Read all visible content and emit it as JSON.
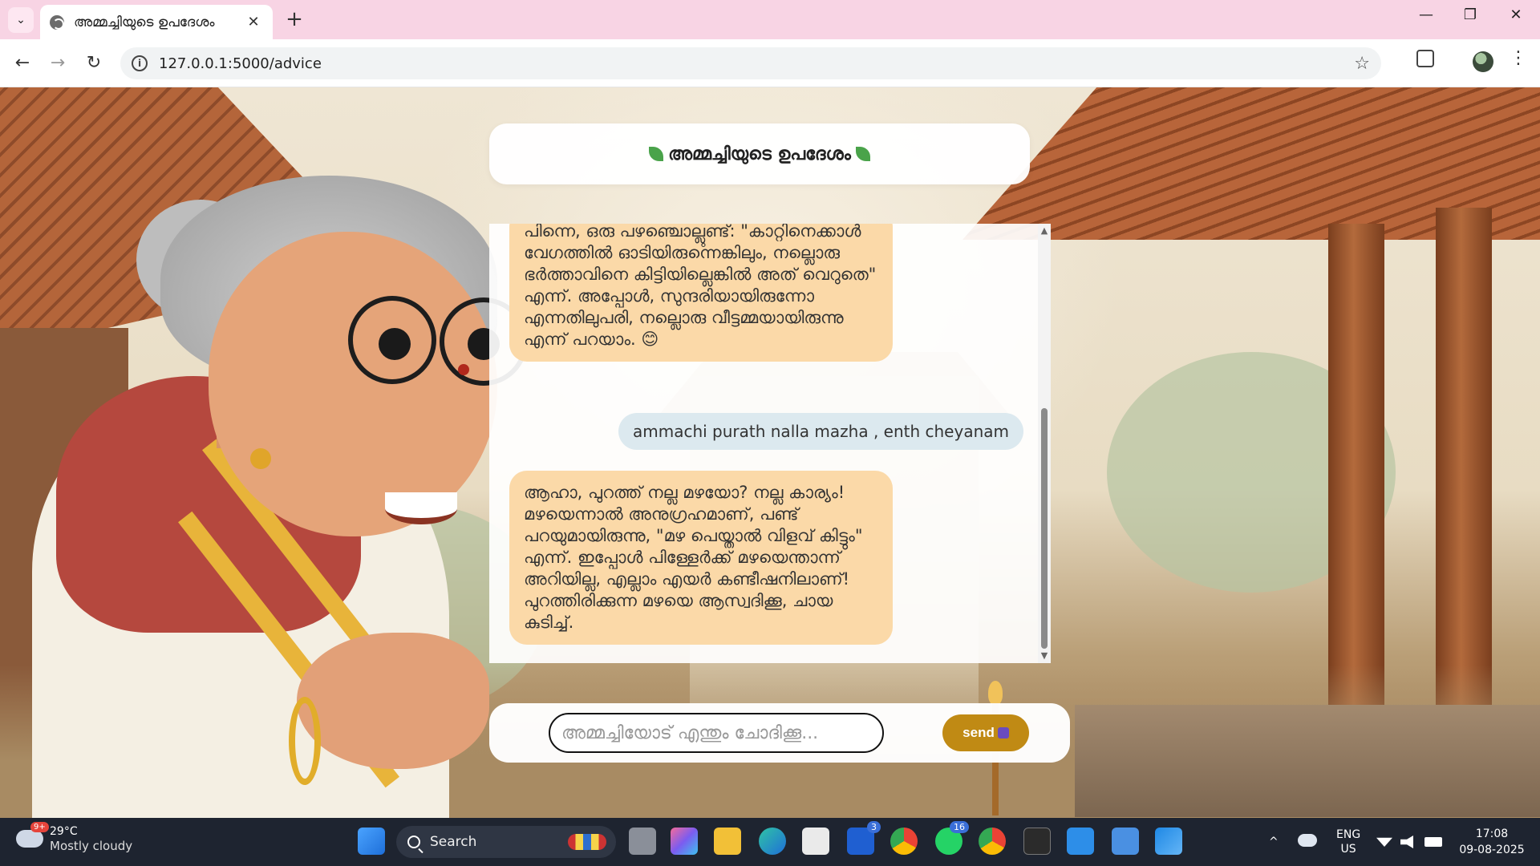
{
  "browser": {
    "tab_title": "അമ്മച്ചിയുടെ ഉപദേശം",
    "url": "127.0.0.1:5000/advice",
    "tab_list_glyph": "⌄",
    "close_glyph": "✕",
    "new_tab_glyph": "+",
    "back_glyph": "←",
    "forward_glyph": "→",
    "reload_glyph": "↻",
    "star_glyph": "☆",
    "menu_glyph": "⋮",
    "minimize_glyph": "—",
    "restore_glyph": "❐",
    "window_close_glyph": "✕"
  },
  "chat": {
    "header_title": "അമ്മച്ചിയുടെ ഉപദേശം",
    "messages": [
      {
        "from": "ammachi",
        "text": "പിന്നെ, ഒരു പഴഞ്ചൊല്ലുണ്ട്: \"കാറ്റിനെക്കാൾ വേഗത്തിൽ ഓടിയിരുന്നെങ്കിലും, നല്ലൊരു ഭർത്താവിനെ കിട്ടിയില്ലെങ്കിൽ അത് വെറുതെ\" എന്ന്. അപ്പോൾ, സുന്ദരിയായിരുന്നോ എന്നതിലുപരി, നല്ലൊരു വീട്ടമ്മയായിരുന്നു എന്ന് പറയാം. 😊"
      },
      {
        "from": "user",
        "text": "ammachi purath nalla mazha , enth cheyanam"
      },
      {
        "from": "ammachi",
        "text": "ആഹാ, പുറത്ത് നല്ല മഴയോ? നല്ല കാര്യം! മഴയെന്നാൽ അനുഗ്രഹമാണ്, പണ്ട് പറയുമായിരുന്നു, \"മഴ പെയ്താൽ വിളവ് കിട്ടും\" എന്ന്. ഇപ്പോൾ പിള്ളേർക്ക് മഴയെന്താന്ന് അറിയില്ല, എല്ലാം എയർ കണ്ടീഷനിലാണ്! പുറത്തിരിക്കുന്ന മഴയെ ആസ്വദിക്കൂ, ചായ കുടിച്ച്."
      }
    ],
    "input_placeholder": "അമ്മച്ചിയോട് എന്തും ചോദിക്കൂ...",
    "send_label": "send",
    "scroll_up_glyph": "▲",
    "scroll_down_glyph": "▼"
  },
  "taskbar": {
    "weather_temp": "29°C",
    "weather_condition": "Mostly cloudy",
    "weather_badge": "9+",
    "search_label": "Search",
    "badges": {
      "l_app": "3",
      "whatsapp": "16"
    },
    "lang_line1": "ENG",
    "lang_line2": "US",
    "time": "17:08",
    "date": "09-08-2025",
    "tray_chevron": "^"
  },
  "colors": {
    "tabstrip": "#f8d4e4",
    "ammachi_bubble": "#fbd9a8",
    "user_bubble": "#dce9ef",
    "send_button": "#c08a14",
    "taskbar": "#1e2430"
  }
}
